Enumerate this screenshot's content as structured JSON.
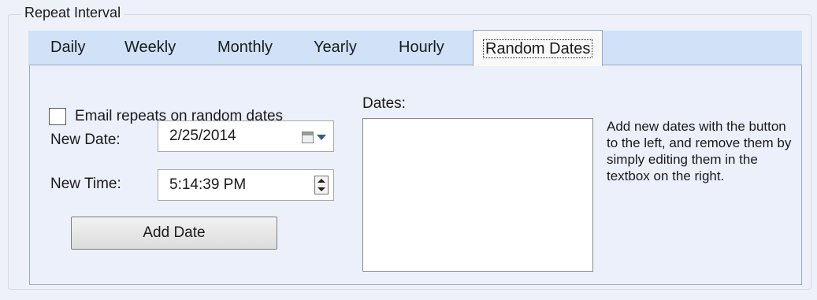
{
  "group": {
    "title": "Repeat Interval"
  },
  "tabs": [
    {
      "label": "Daily",
      "active": false
    },
    {
      "label": "Weekly",
      "active": false
    },
    {
      "label": "Monthly",
      "active": false
    },
    {
      "label": "Yearly",
      "active": false
    },
    {
      "label": "Hourly",
      "active": false
    },
    {
      "label": "Random Dates",
      "active": true
    }
  ],
  "random_dates": {
    "checkbox_label": "Email repeats on random dates",
    "checkbox_checked": false,
    "new_date_label": "New Date:",
    "new_date_value": "2/25/2014",
    "new_time_label": "New Time:",
    "new_time_value": "5:14:39 PM",
    "add_button_label": "Add Date",
    "dates_label": "Dates:",
    "dates_value": "",
    "help_text": "Add new dates with the button to the left, and remove them by simply editing them in the textbox on the right."
  }
}
